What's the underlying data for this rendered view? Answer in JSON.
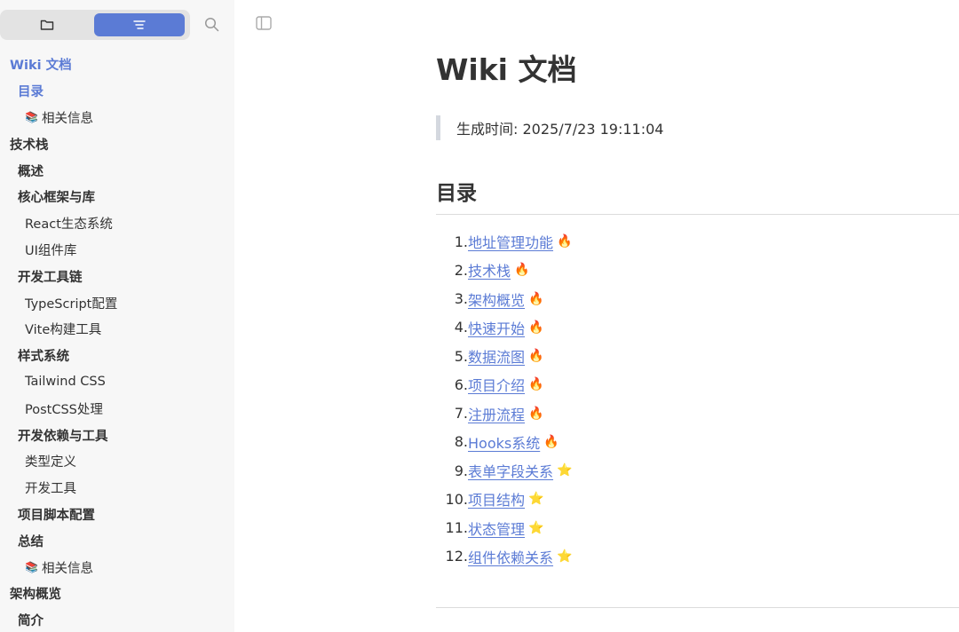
{
  "sidebar": {
    "tabs": [
      {
        "icon": "folder-icon"
      },
      {
        "icon": "outline-icon",
        "active": true
      }
    ],
    "search_icon": "search-icon",
    "items": [
      {
        "label": "Wiki 文档",
        "level": 1,
        "active": true
      },
      {
        "label": "目录",
        "level": 2,
        "active": true
      },
      {
        "label": "相关信息",
        "level": 3,
        "book": true
      },
      {
        "label": "技术栈",
        "level": 1
      },
      {
        "label": "概述",
        "level": 2
      },
      {
        "label": "核心框架与库",
        "level": 2
      },
      {
        "label": "React生态系统",
        "level": 3
      },
      {
        "label": "UI组件库",
        "level": 3
      },
      {
        "label": "开发工具链",
        "level": 2
      },
      {
        "label": "TypeScript配置",
        "level": 3
      },
      {
        "label": "Vite构建工具",
        "level": 3
      },
      {
        "label": "样式系统",
        "level": 2
      },
      {
        "label": "Tailwind CSS",
        "level": 3
      },
      {
        "label": "PostCSS处理",
        "level": 3
      },
      {
        "label": "开发依赖与工具",
        "level": 2
      },
      {
        "label": "类型定义",
        "level": 3
      },
      {
        "label": "开发工具",
        "level": 3
      },
      {
        "label": "项目脚本配置",
        "level": 2
      },
      {
        "label": "总结",
        "level": 2
      },
      {
        "label": "相关信息",
        "level": 3,
        "book": true
      },
      {
        "label": "架构概览",
        "level": 1
      },
      {
        "label": "简介",
        "level": 2
      }
    ]
  },
  "toolbar": {
    "toggle_icon": "sidebar-toggle-icon"
  },
  "document": {
    "title": "Wiki 文档",
    "generated": "生成时间: 2025/7/23 19:11:04",
    "toc_heading": "目录",
    "toc": [
      {
        "num": "1.",
        "label": "地址管理功能",
        "badge": "🔥"
      },
      {
        "num": "2.",
        "label": "技术栈",
        "badge": "🔥"
      },
      {
        "num": "3.",
        "label": "架构概览",
        "badge": "🔥"
      },
      {
        "num": "4.",
        "label": "快速开始",
        "badge": "🔥"
      },
      {
        "num": "5.",
        "label": "数据流图",
        "badge": "🔥"
      },
      {
        "num": "6.",
        "label": "项目介绍",
        "badge": "🔥"
      },
      {
        "num": "7.",
        "label": "注册流程",
        "badge": "🔥"
      },
      {
        "num": "8.",
        "label": "Hooks系统",
        "badge": "🔥"
      },
      {
        "num": "9.",
        "label": "表单字段关系",
        "badge": "⭐"
      },
      {
        "num": "10.",
        "label": "项目结构",
        "badge": "⭐"
      },
      {
        "num": "11.",
        "label": "状态管理",
        "badge": "⭐"
      },
      {
        "num": "12.",
        "label": "组件依赖关系",
        "badge": "⭐"
      }
    ]
  },
  "colors": {
    "accent": "#5b7bd5",
    "sidebar_bg": "#f7f7f7",
    "text": "#333333"
  }
}
